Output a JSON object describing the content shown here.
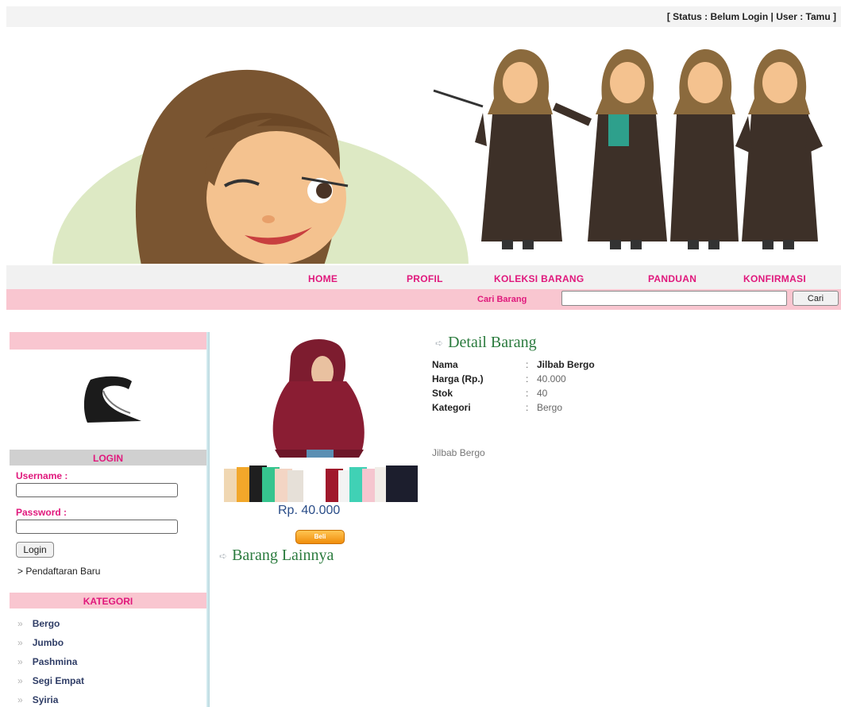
{
  "status": {
    "text": "[ Status : Belum Login | User : Tamu ]"
  },
  "nav": {
    "items": [
      "HOME",
      "PROFIL",
      "KOLEKSI BARANG",
      "PANDUAN",
      "KONFIRMASI"
    ]
  },
  "search": {
    "label": "Cari Barang",
    "button": "Cari",
    "placeholder": ""
  },
  "sidebar": {
    "login_heading": "LOGIN",
    "username_label": "Username :",
    "password_label": "Password :",
    "login_button": "Login",
    "register_link": "> Pendaftaran Baru",
    "kategori_heading": "KATEGORI",
    "kategori_bullet": "»",
    "kategori": [
      "Bergo",
      "Jumbo",
      "Pashmina",
      "Segi Empat",
      "Syiria"
    ]
  },
  "product": {
    "price": "Rp. 40.000",
    "buy_button": "Beli",
    "detail_title": "Detail Barang",
    "others_title": "Barang Lainnya",
    "fields": [
      {
        "label": "Nama",
        "value": "Jilbab Bergo"
      },
      {
        "label": "Harga (Rp.)",
        "value": "40.000"
      },
      {
        "label": "Stok",
        "value": "40"
      },
      {
        "label": "Kategori",
        "value": "Bergo"
      }
    ],
    "description": "Jilbab Bergo",
    "colon": ":"
  },
  "colors": {
    "accent": "#e0187c",
    "pink_bar": "#f9c6d0",
    "title_green": "#2b7b3e",
    "price_blue": "#2a4d88"
  }
}
